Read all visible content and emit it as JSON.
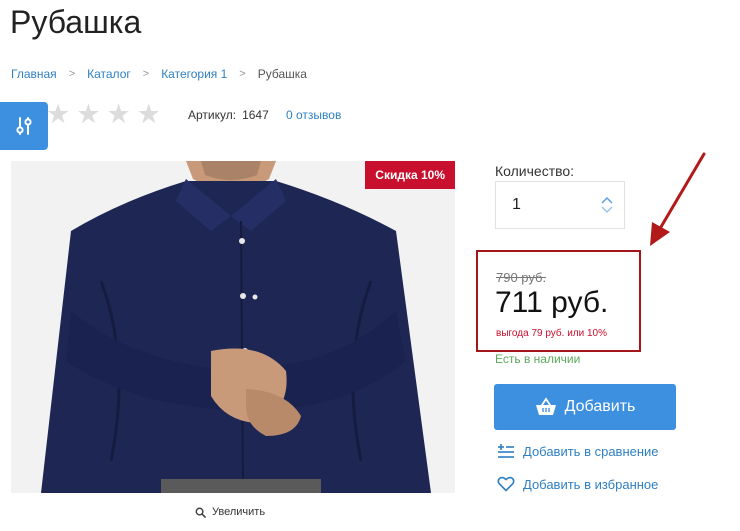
{
  "product": {
    "title": "Рубашка",
    "sku_label": "Артикул:",
    "sku_value": "1647",
    "reviews_link": "0 отзывов",
    "rating": 0
  },
  "breadcrumb": {
    "items": [
      "Главная",
      "Каталог",
      "Категория 1",
      "Рубашка"
    ]
  },
  "image": {
    "discount_badge": "Скидка 10%",
    "zoom_label": "Увеличить"
  },
  "quantity": {
    "label": "Количество:",
    "value": "1"
  },
  "price": {
    "old": "790 руб.",
    "current": "711 руб.",
    "savings": "выгода 79 руб. или 10%"
  },
  "stock": {
    "status": "Есть в наличии"
  },
  "actions": {
    "add_label": "Добавить",
    "compare_label": "Добавить в сравнение",
    "favorite_label": "Добавить в избранное"
  },
  "colors": {
    "accent": "#3d8fe0",
    "link": "#2f7fc1",
    "badge": "#c8102e",
    "highlight_border": "#a4161a",
    "in_stock": "#5aa95a"
  },
  "icons": {
    "filter": "sliders-icon",
    "zoom": "search-icon",
    "add": "basket-icon",
    "compare": "compare-list-icon",
    "favorite": "heart-icon"
  }
}
